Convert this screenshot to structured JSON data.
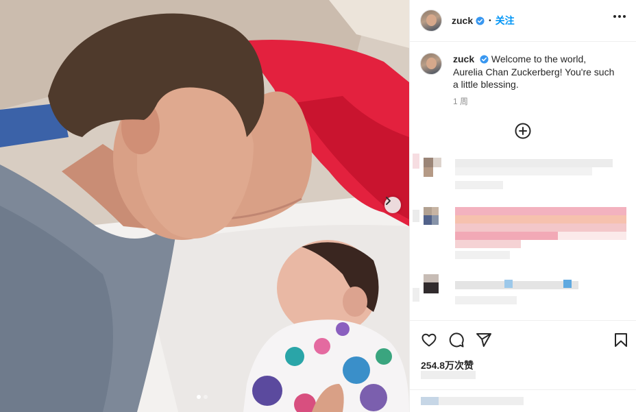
{
  "post": {
    "author": "zuck",
    "follow_label": "关注",
    "caption_user": "zuck",
    "caption_text": "Welcome to the world, Aurelia Chan Zuckerberg! You're such a little blessing.",
    "time_ago": "1 周",
    "likes": "254.8万次赞"
  },
  "media": {
    "carousel_total": 2,
    "carousel_active": 1
  },
  "colors": {
    "accent": "#0095f6",
    "verified": "#3897f0",
    "blanket_red": "#e3213e"
  },
  "icons": {
    "verified": "verified-badge-icon",
    "more": "more-options-icon",
    "add_comment": "plus-circle-icon",
    "like": "heart-icon",
    "comment": "comment-bubble-icon",
    "share": "paper-plane-icon",
    "save": "bookmark-icon",
    "next": "chevron-right-icon"
  }
}
